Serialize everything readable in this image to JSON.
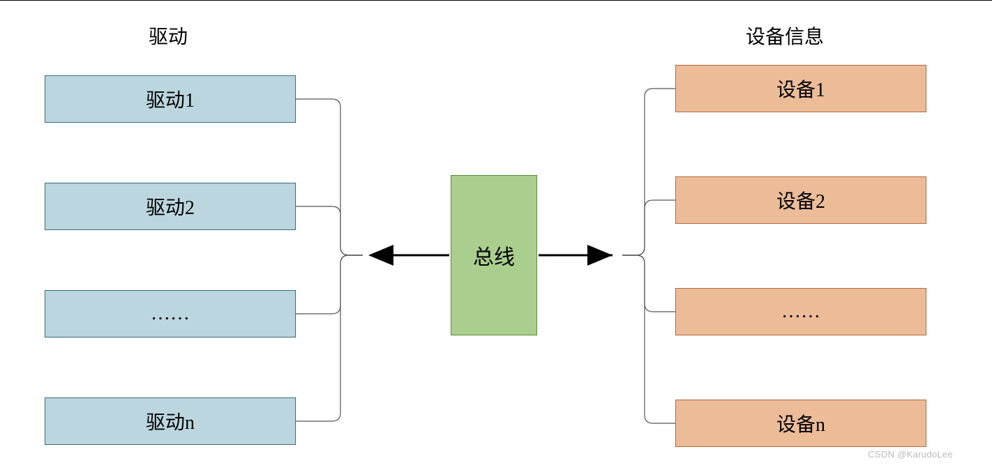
{
  "left": {
    "header": "驱动",
    "items": [
      "驱动1",
      "驱动2",
      "……",
      "驱动n"
    ]
  },
  "center": {
    "label": "总线"
  },
  "right": {
    "header": "设备信息",
    "items": [
      "设备1",
      "设备2",
      "……",
      "设备n"
    ]
  },
  "watermark": "CSDN @KarudoLee",
  "colors": {
    "blue_fill": "#bbd6df",
    "blue_border": "#3a6a7a",
    "orange_fill": "#ecbc99",
    "orange_border": "#b06a3a",
    "green_fill": "#a9ce8d",
    "green_border": "#5a8a3a"
  }
}
